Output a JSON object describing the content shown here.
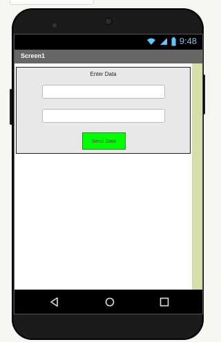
{
  "status_bar": {
    "time": "9:48",
    "icons": [
      "wifi-icon",
      "signal-icon",
      "battery-icon"
    ],
    "accent": "#5fc7ff"
  },
  "app": {
    "title": "Screen1",
    "title_bar_color": "#666666"
  },
  "form": {
    "label": "Enter Data",
    "inputs": [
      {
        "value": "",
        "placeholder": ""
      },
      {
        "value": "",
        "placeholder": ""
      }
    ],
    "send_button_label": "Send Data",
    "send_button_color": "#00ff00"
  },
  "nav": {
    "icons": [
      "back-icon",
      "home-icon",
      "recent-apps-icon"
    ]
  },
  "colors": {
    "right_stripe": "#d4e0a9",
    "panel_background": "#e8e8e8"
  }
}
